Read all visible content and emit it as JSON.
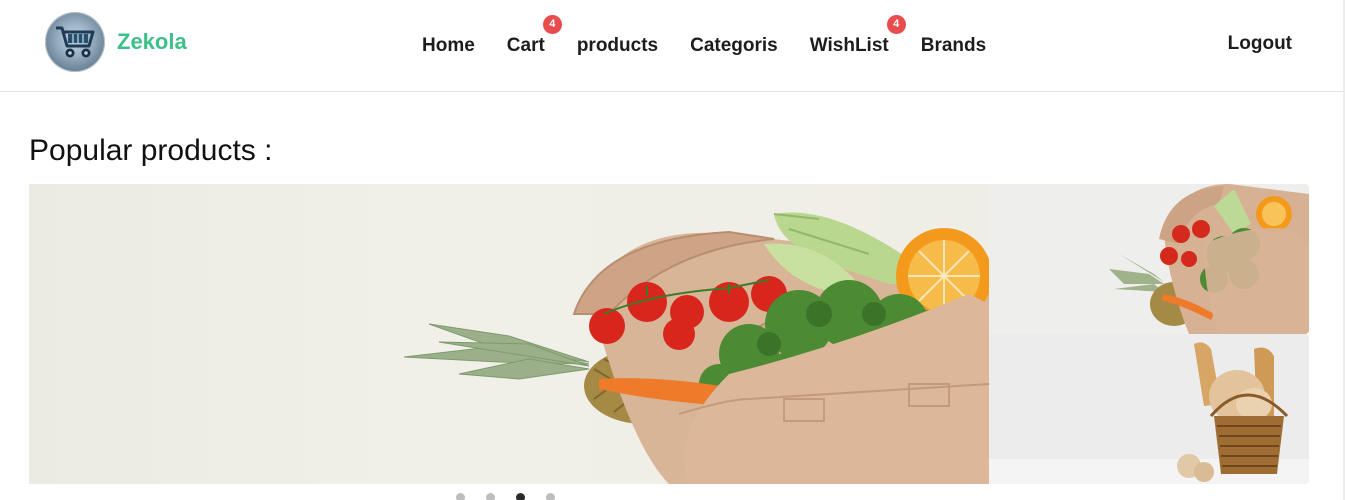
{
  "brand": {
    "name": "Zekola",
    "logo_icon": "shopping-cart-logo-icon"
  },
  "nav": {
    "items": [
      {
        "label": "Home"
      },
      {
        "label": "Cart",
        "badge": "4"
      },
      {
        "label": "products"
      },
      {
        "label": "Categoris"
      },
      {
        "label": "WishList",
        "badge": "4"
      },
      {
        "label": "Brands"
      }
    ],
    "logout": "Logout"
  },
  "main": {
    "title": "Popular products :",
    "slider": {
      "main_image": "grocery-bag-vegetables-image",
      "side_images": [
        "grocery-bag-vegetables-image",
        "bread-basket-image"
      ],
      "dots_count": 4,
      "active_dot": 3
    }
  },
  "colors": {
    "brand": "#3cbf88",
    "badge": "#e84c4c",
    "text": "#1d1d1d"
  }
}
